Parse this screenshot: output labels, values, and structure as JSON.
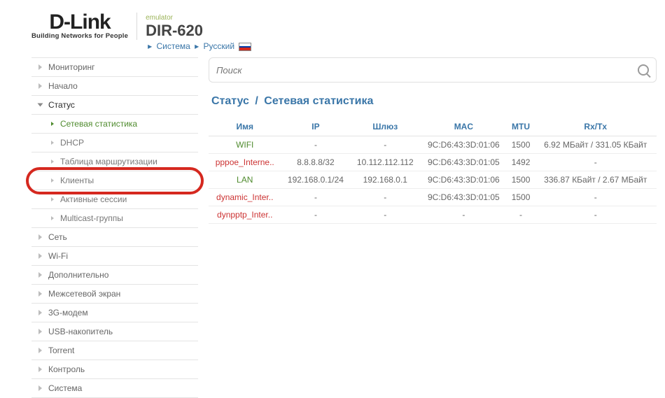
{
  "header": {
    "brand": "D-Link",
    "tagline": "Building Networks for People",
    "emulator": "emulator",
    "model": "DIR-620",
    "crumb1": "Система",
    "crumb2": "Русский"
  },
  "search": {
    "placeholder": "Поиск"
  },
  "breadcrumb": {
    "section": "Статус",
    "page": "Сетевая статистика"
  },
  "sidebar": {
    "items": [
      {
        "label": "Мониторинг",
        "type": "top"
      },
      {
        "label": "Начало",
        "type": "top"
      },
      {
        "label": "Статус",
        "type": "top-open"
      },
      {
        "label": "Сетевая статистика",
        "type": "sub-active"
      },
      {
        "label": "DHCP",
        "type": "sub"
      },
      {
        "label": "Таблица маршрутизации",
        "type": "sub"
      },
      {
        "label": "Клиенты",
        "type": "sub-highlight"
      },
      {
        "label": "Активные сессии",
        "type": "sub"
      },
      {
        "label": "Multicast-группы",
        "type": "sub"
      },
      {
        "label": "Сеть",
        "type": "top"
      },
      {
        "label": "Wi-Fi",
        "type": "top"
      },
      {
        "label": "Дополнительно",
        "type": "top"
      },
      {
        "label": "Межсетевой экран",
        "type": "top"
      },
      {
        "label": "3G-модем",
        "type": "top"
      },
      {
        "label": "USB-накопитель",
        "type": "top"
      },
      {
        "label": "Torrent",
        "type": "top"
      },
      {
        "label": "Контроль",
        "type": "top"
      },
      {
        "label": "Система",
        "type": "top"
      }
    ]
  },
  "table": {
    "headers": {
      "name": "Имя",
      "ip": "IP",
      "gw": "Шлюз",
      "mac": "MAC",
      "mtu": "MTU",
      "rxtx": "Rx/Tx"
    },
    "rows": [
      {
        "name": "WIFI",
        "cls": "green",
        "ip": "-",
        "gw": "-",
        "mac": "9C:D6:43:3D:01:06",
        "mtu": "1500",
        "rxtx": "6.92 МБайт / 331.05 КБайт"
      },
      {
        "name": "pppoe_Interne..",
        "cls": "red",
        "ip": "8.8.8.8/32",
        "gw": "10.112.112.112",
        "mac": "9C:D6:43:3D:01:05",
        "mtu": "1492",
        "rxtx": "-"
      },
      {
        "name": "LAN",
        "cls": "green",
        "ip": "192.168.0.1/24",
        "gw": "192.168.0.1",
        "mac": "9C:D6:43:3D:01:06",
        "mtu": "1500",
        "rxtx": "336.87 КБайт / 2.67 МБайт"
      },
      {
        "name": "dynamic_Inter..",
        "cls": "red",
        "ip": "-",
        "gw": "-",
        "mac": "9C:D6:43:3D:01:05",
        "mtu": "1500",
        "rxtx": "-"
      },
      {
        "name": "dynpptp_Inter..",
        "cls": "red",
        "ip": "-",
        "gw": "-",
        "mac": "-",
        "mtu": "-",
        "rxtx": "-"
      }
    ]
  }
}
